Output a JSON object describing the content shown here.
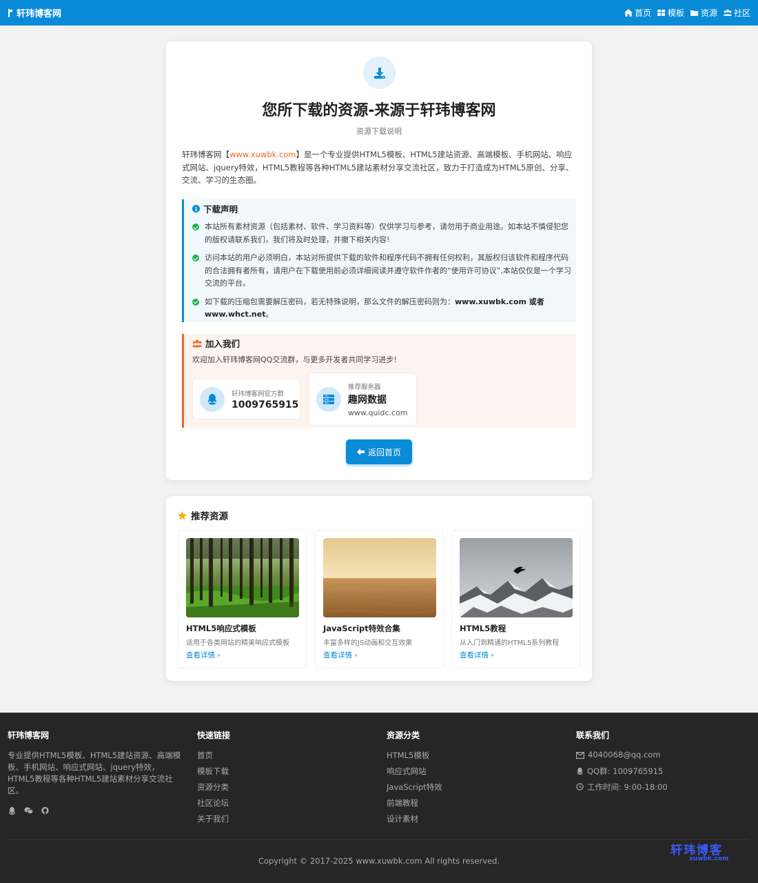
{
  "nav": {
    "brand": "轩玮博客网",
    "links": [
      {
        "label": "首页",
        "icon": "home-icon"
      },
      {
        "label": "模板",
        "icon": "grid-icon"
      },
      {
        "label": "资源",
        "icon": "folder-icon"
      },
      {
        "label": "社区",
        "icon": "users-icon"
      }
    ]
  },
  "main": {
    "title": "您所下载的资源-来源于轩玮博客网",
    "subtitle": "资源下载说明",
    "intro_prefix": "轩玮博客网【",
    "intro_link": "www.xuwbk.com",
    "intro_suffix": "】是一个专业提供HTML5模板、HTML5建站资源、高端模板、手机网站、响应式网站、jquery特效，HTML5教程等各种HTML5建站素材分享交流社区，致力于打造成为HTML5原创、分享、交流、学习的生态圈。",
    "notice": {
      "title": "下载声明",
      "items": [
        "本站所有素材资源（包括素材、软件、学习资料等）仅供学习与参考，请勿用于商业用途。如本站不慎侵犯您的版权请联系我们，我们将及时处理，并撤下相关内容!",
        "访问本站的用户必须明白，本站对所提供下载的软件和程序代码不拥有任何权利，其版权归该软件和程序代码的合法拥有者所有，请用户在下载使用前必须详细阅读并遵守软件作者的“使用许可协议”,本站仅仅是一个学习交流的平台。"
      ],
      "item3_prefix": "如下载的压缩包需要解压密码，若无特殊说明，那么文件的解压密码则为：",
      "item3_bold": "www.xuwbk.com 或者 www.whct.net",
      "item3_suffix": "。"
    },
    "join": {
      "title": "加入我们",
      "desc": "欢迎加入轩玮博客网QQ交流群，与更多开发者共同学习进步!",
      "qq_label": "轩玮博客网官方群",
      "qq_number": "1009765915",
      "server_label": "推荐服务器",
      "server_name": "趣网数据",
      "server_url": "www.quidc.com"
    },
    "back_button": "返回首页"
  },
  "recommend": {
    "title": "推荐资源",
    "items": [
      {
        "name": "HTML5响应式模板",
        "desc": "适用于各类网站的精美响应式模板",
        "more": "查看详情"
      },
      {
        "name": "JavaScript特效合集",
        "desc": "丰富多样的JS动画和交互效果",
        "more": "查看详情"
      },
      {
        "name": "HTML5教程",
        "desc": "从入门到精通的HTML5系列教程",
        "more": "查看详情"
      }
    ]
  },
  "footer": {
    "about_title": "轩玮博客网",
    "about_desc": "专业提供HTML5模板、HTML5建站资源、高端模板、手机网站、响应式网站、jquery特效，HTML5教程等各种HTML5建站素材分享交流社区。",
    "quick_title": "快速链接",
    "quick_links": [
      "首页",
      "模板下载",
      "资源分类",
      "社区论坛",
      "关于我们"
    ],
    "cat_title": "资源分类",
    "cat_links": [
      "HTML5模板",
      "响应式网站",
      "JavaScript特效",
      "前端教程",
      "设计素材"
    ],
    "contact_title": "联系我们",
    "email": "4040068@qq.com",
    "qq_group": "QQ群: 1009765915",
    "hours": "工作时间: 9:00-18:00",
    "copyright": "Copyright © 2017-2025 www.xuwbk.com All rights reserved.",
    "watermark_cn": "轩玮博客",
    "watermark_en": "xuwbk.com"
  },
  "colors": {
    "primary": "#0a8bd8",
    "accent": "#f26522",
    "success": "#22b14c",
    "footer_bg": "#262626"
  }
}
